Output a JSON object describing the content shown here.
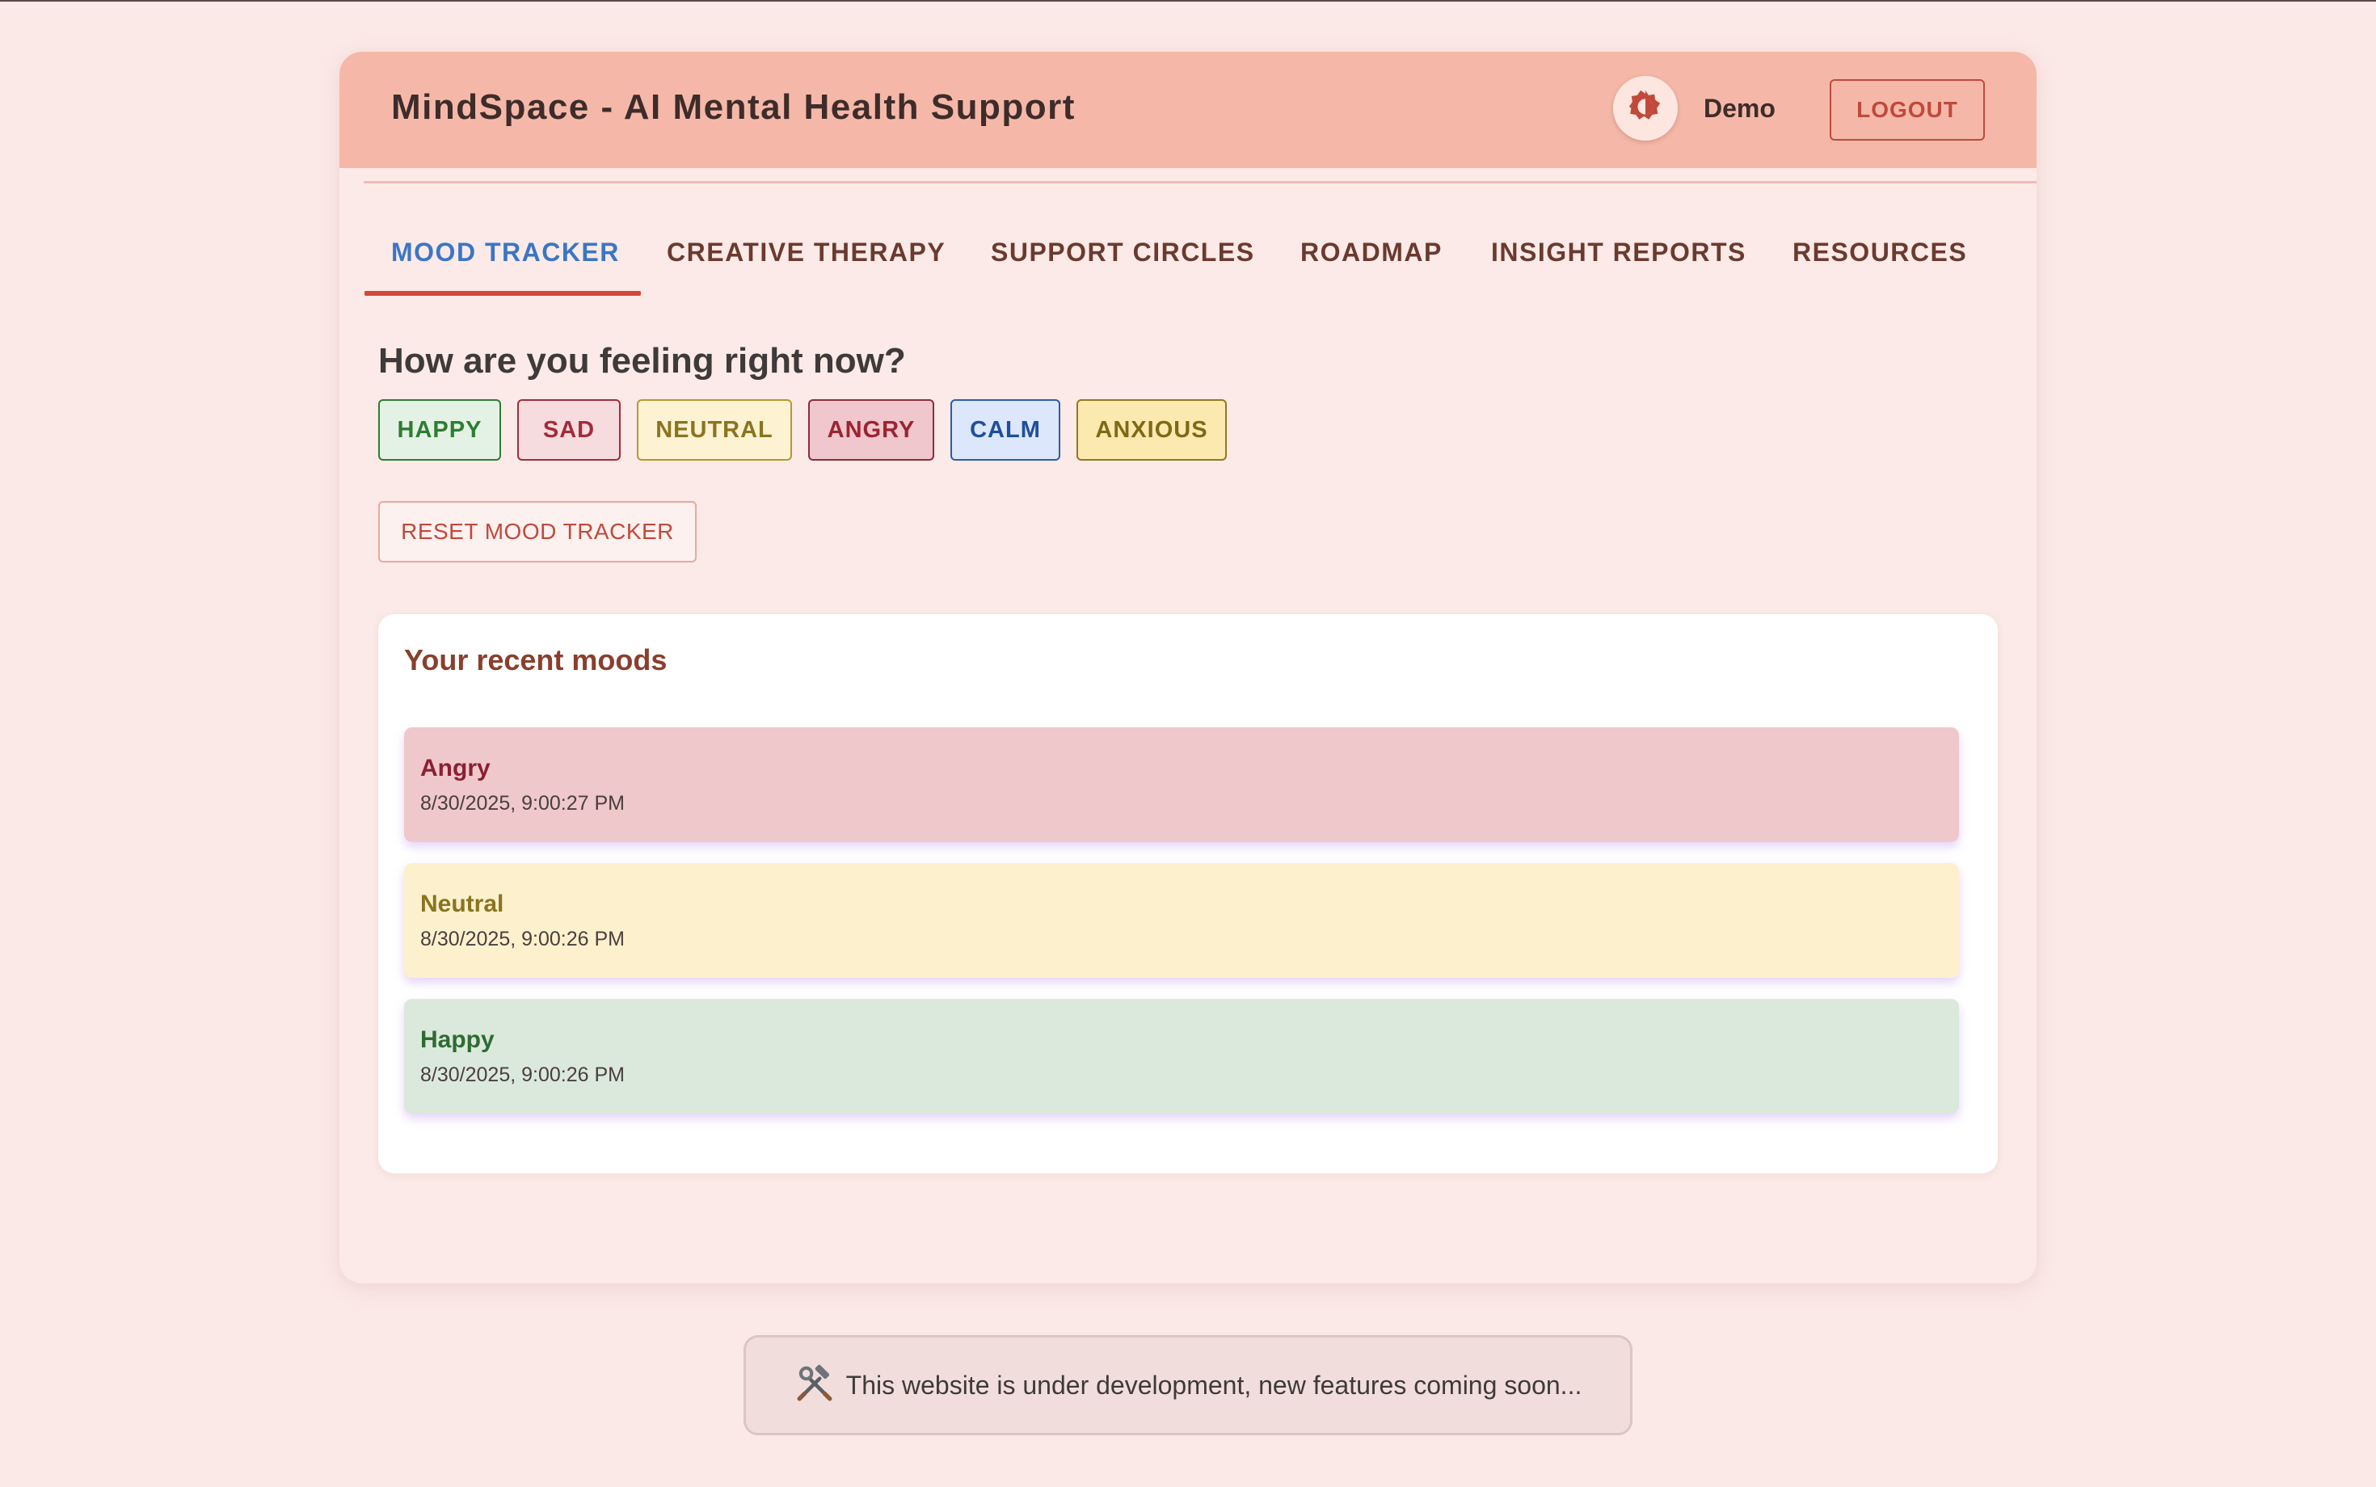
{
  "app": {
    "title": "MindSpace - AI Mental Health Support",
    "username": "Demo",
    "logout_label": "LOGOUT",
    "theme_icon": "brightness-icon"
  },
  "tabs": [
    {
      "label": "MOOD TRACKER",
      "active": true
    },
    {
      "label": "CREATIVE THERAPY",
      "active": false
    },
    {
      "label": "SUPPORT CIRCLES",
      "active": false
    },
    {
      "label": "ROADMAP",
      "active": false
    },
    {
      "label": "INSIGHT REPORTS",
      "active": false
    },
    {
      "label": "RESOURCES",
      "active": false
    }
  ],
  "mood_tracker": {
    "question": "How are you feeling right now?",
    "moods": [
      {
        "label": "HAPPY",
        "text_color": "#2e7d32",
        "bg": "#e3f2e4",
        "border": "#2e7d32"
      },
      {
        "label": "SAD",
        "text_color": "#a32b3a",
        "bg": "#f6dcdf",
        "border": "#a32b3a"
      },
      {
        "label": "NEUTRAL",
        "text_color": "#8a7420",
        "bg": "#fdf3d2",
        "border": "#b59a2e"
      },
      {
        "label": "ANGRY",
        "text_color": "#9c2333",
        "bg": "#efc7cc",
        "border": "#8e2c3a"
      },
      {
        "label": "CALM",
        "text_color": "#1f4e9c",
        "bg": "#dce7fb",
        "border": "#2c5cad"
      },
      {
        "label": "ANXIOUS",
        "text_color": "#7f6a14",
        "bg": "#fbe9b0",
        "border": "#8e7a20"
      }
    ],
    "reset_label": "RESET MOOD TRACKER",
    "recent": {
      "title": "Your recent moods",
      "entries": [
        {
          "name": "Angry",
          "time": "8/30/2025, 9:00:27 PM",
          "bg": "#efc8cc",
          "name_color": "#8c1f32"
        },
        {
          "name": "Neutral",
          "time": "8/30/2025, 9:00:26 PM",
          "bg": "#fdf1cd",
          "name_color": "#8a7420"
        },
        {
          "name": "Happy",
          "time": "8/30/2025, 9:00:26 PM",
          "bg": "#dae9dc",
          "name_color": "#2e6b33"
        }
      ]
    }
  },
  "banner": {
    "icon": "hammer-wrench-icon",
    "text": "This website is under development, new features coming soon..."
  },
  "colors": {
    "accent": "#d2483a",
    "active_tab": "#3b76c4",
    "header_bg": "#f5b8a8",
    "page_bg": "#fbe9e7"
  }
}
